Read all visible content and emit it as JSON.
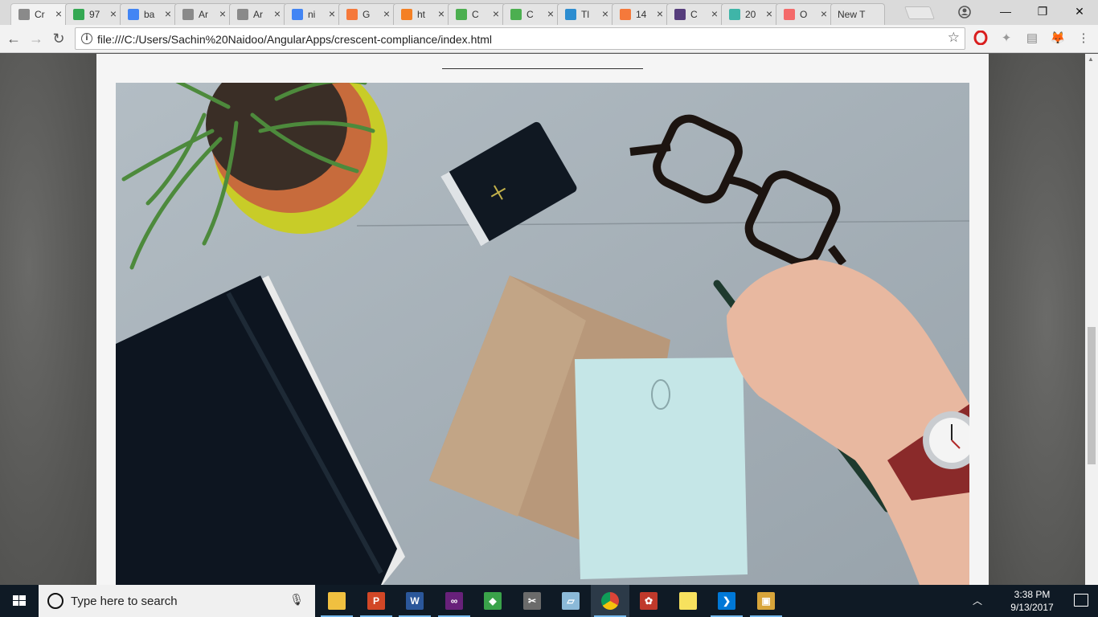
{
  "tabs": [
    {
      "label": "Cr",
      "icon": "page-icon",
      "color": "#8a8a8a",
      "active": true
    },
    {
      "label": "97",
      "icon": "maps-icon",
      "color": "#34a853"
    },
    {
      "label": "ba",
      "icon": "google-icon",
      "color": "#4285f4"
    },
    {
      "label": "Ar",
      "icon": "page-icon",
      "color": "#8a8a8a"
    },
    {
      "label": "Ar",
      "icon": "page-icon",
      "color": "#8a8a8a"
    },
    {
      "label": "ni",
      "icon": "google-icon",
      "color": "#4285f4"
    },
    {
      "label": "G",
      "icon": "bb-icon",
      "color": "#f5793b"
    },
    {
      "label": "ht",
      "icon": "stackoverflow-icon",
      "color": "#f48024"
    },
    {
      "label": "C",
      "icon": "w3-icon",
      "color": "#4caf50"
    },
    {
      "label": "C",
      "icon": "w3-icon",
      "color": "#4caf50"
    },
    {
      "label": "Tl",
      "icon": "s-icon",
      "color": "#2d8dd0"
    },
    {
      "label": "14",
      "icon": "bb-icon",
      "color": "#f5793b"
    },
    {
      "label": "C",
      "icon": "bootstrap-icon",
      "color": "#563d7c"
    },
    {
      "label": "20",
      "icon": "teal-icon",
      "color": "#3fb5a8"
    },
    {
      "label": "O",
      "icon": "f-icon",
      "color": "#f46a6a"
    },
    {
      "label": "New T",
      "icon": "none",
      "color": "#e4e4e4"
    }
  ],
  "window": {
    "minimize": "—",
    "restore": "❐",
    "close": "✕"
  },
  "toolbar": {
    "back": "←",
    "forward": "→",
    "reload": "↻",
    "info": "i",
    "url": "file:///C:/Users/Sachin%20Naidoo/AngularApps/crescent-compliance/index.html",
    "star": "☆",
    "menu": "⋮"
  },
  "taskbar": {
    "search_placeholder": "Type here to search",
    "apps": [
      {
        "name": "file-explorer",
        "glyph": "",
        "color": "#f0c040",
        "running": true
      },
      {
        "name": "powerpoint",
        "glyph": "P",
        "color": "#d24726",
        "running": true
      },
      {
        "name": "word",
        "glyph": "W",
        "color": "#2b579a",
        "running": true
      },
      {
        "name": "visual-studio",
        "glyph": "∞",
        "color": "#68217a",
        "running": true
      },
      {
        "name": "git",
        "glyph": "◆",
        "color": "#3aa34a",
        "running": false
      },
      {
        "name": "snipping-tool",
        "glyph": "✂",
        "color": "#6b6b6b",
        "running": false
      },
      {
        "name": "notepad",
        "glyph": "▱",
        "color": "#8bb9d8",
        "running": false
      },
      {
        "name": "chrome",
        "glyph": "",
        "color": "#db4437",
        "running": true,
        "active": true
      },
      {
        "name": "angular-tool",
        "glyph": "✿",
        "color": "#c0392b",
        "running": false
      },
      {
        "name": "sticky-notes",
        "glyph": "",
        "color": "#f7e15e",
        "running": false
      },
      {
        "name": "vs-code",
        "glyph": "❯",
        "color": "#0078d7",
        "running": true
      },
      {
        "name": "package-app",
        "glyph": "▣",
        "color": "#d8a53a",
        "running": true
      }
    ],
    "time": "3:38 PM",
    "date": "9/13/2017"
  }
}
